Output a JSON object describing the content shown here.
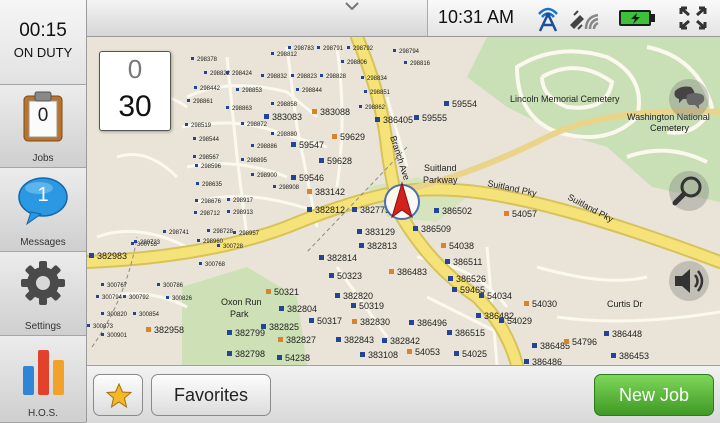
{
  "sidebar": {
    "clock": {
      "time": "00:15",
      "status": "ON DUTY"
    },
    "jobs": {
      "label": "Jobs",
      "count": "0"
    },
    "messages": {
      "label": "Messages",
      "count": "1"
    },
    "settings": {
      "label": "Settings"
    },
    "hos": {
      "label": "H.O.S."
    }
  },
  "status_bar": {
    "time": "10:31 AM"
  },
  "speed": {
    "limit": "0",
    "current": "30"
  },
  "map": {
    "place_labels": {
      "lincoln": "Lincoln Memorial Cemetery",
      "washington_1": "Washington National",
      "washington_2": "Cemetery",
      "suitland_1": "Suitland",
      "suitland_2": "Parkway",
      "suitland_pky_1": "Suitland Pky",
      "suitland_pky_2": "Suitland Pky",
      "branch_ave": "Branch Ave",
      "oxon_1": "Oxon Run",
      "oxon_2": "Park",
      "curtis": "Curtis Dr"
    },
    "large_labels": [
      "383083",
      "383088",
      "59554",
      "386405",
      "59555",
      "59629",
      "59547",
      "59628",
      "59546",
      "383142",
      "382812",
      "382775",
      "386502",
      "54057",
      "386509",
      "383129",
      "382813",
      "54038",
      "382983",
      "382814",
      "386511",
      "386483",
      "386526",
      "50323",
      "59465",
      "50321",
      "382820",
      "382804",
      "54034",
      "54030",
      "50319",
      "386482",
      "54029",
      "382958",
      "382799",
      "382825",
      "50317",
      "382830",
      "386496",
      "386515",
      "386448",
      "382827",
      "382843",
      "382842",
      "386485",
      "54796",
      "382798",
      "54238",
      "383108",
      "54053",
      "54025",
      "386486",
      "386453"
    ],
    "small_labels": [
      "298783",
      "298791",
      "298792",
      "298378",
      "298812",
      "298794",
      "298822",
      "298424",
      "298806",
      "298816",
      "298832",
      "298823",
      "298828",
      "298834",
      "298442",
      "298853",
      "298844",
      "298851",
      "298861",
      "298863",
      "298858",
      "298862",
      "298519",
      "298872",
      "298880",
      "298544",
      "298886",
      "298567",
      "298895",
      "298596",
      "298900",
      "298635",
      "298908",
      "298676",
      "298917",
      "298712",
      "298913",
      "298741",
      "298728",
      "298957",
      "298723",
      "298960",
      "300728",
      "300753",
      "300768",
      "300767",
      "300786",
      "300794",
      "300792",
      "300826",
      "300820",
      "300854",
      "300873",
      "300901"
    ]
  },
  "bottom_bar": {
    "favorites_label": "Favorites",
    "new_job_label": "New Job"
  },
  "colors": {
    "accent_green": "#4caf2e",
    "message_blue": "#1f8fdc",
    "hos_red": "#e2412b",
    "route_yellow": "#f5e37a"
  }
}
